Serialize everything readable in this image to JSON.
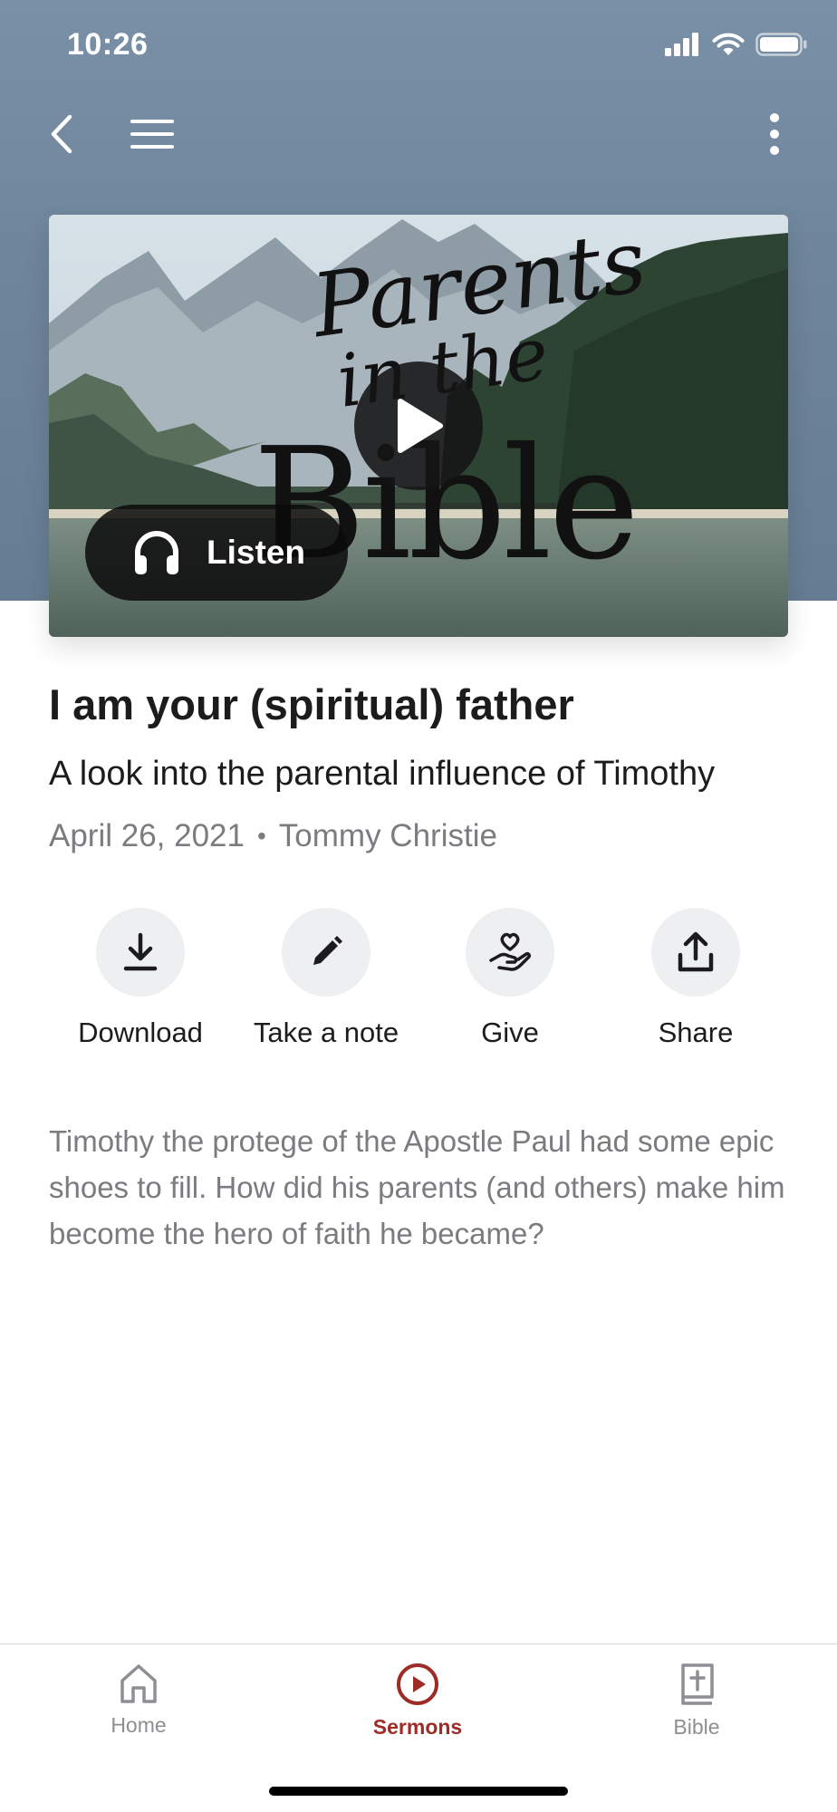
{
  "status_bar": {
    "time": "10:26"
  },
  "artwork": {
    "script_words": [
      "Parents",
      "in the"
    ],
    "big_word": "Bible",
    "listen_label": "Listen"
  },
  "sermon": {
    "title": "I am your (spiritual) father",
    "subtitle": "A look into the parental influence of Timothy",
    "date": "April 26, 2021",
    "separator": "•",
    "speaker": "Tommy Christie",
    "description": "Timothy the protege of the Apostle Paul had some epic shoes to fill. How did his parents (and others) make him become the hero of faith he became?"
  },
  "actions": [
    {
      "label": "Download",
      "icon": "download-icon"
    },
    {
      "label": "Take a note",
      "icon": "pencil-icon"
    },
    {
      "label": "Give",
      "icon": "give-hand-heart-icon"
    },
    {
      "label": "Share",
      "icon": "share-icon"
    }
  ],
  "tabs": [
    {
      "label": "Home",
      "icon": "home-icon",
      "active": false
    },
    {
      "label": "Sermons",
      "icon": "play-circle-icon",
      "active": true
    },
    {
      "label": "Bible",
      "icon": "bible-icon",
      "active": false
    }
  ],
  "colors": {
    "accent": "#9e2b25",
    "header_bg": "#6f859b",
    "muted_text": "#7b7b80"
  }
}
